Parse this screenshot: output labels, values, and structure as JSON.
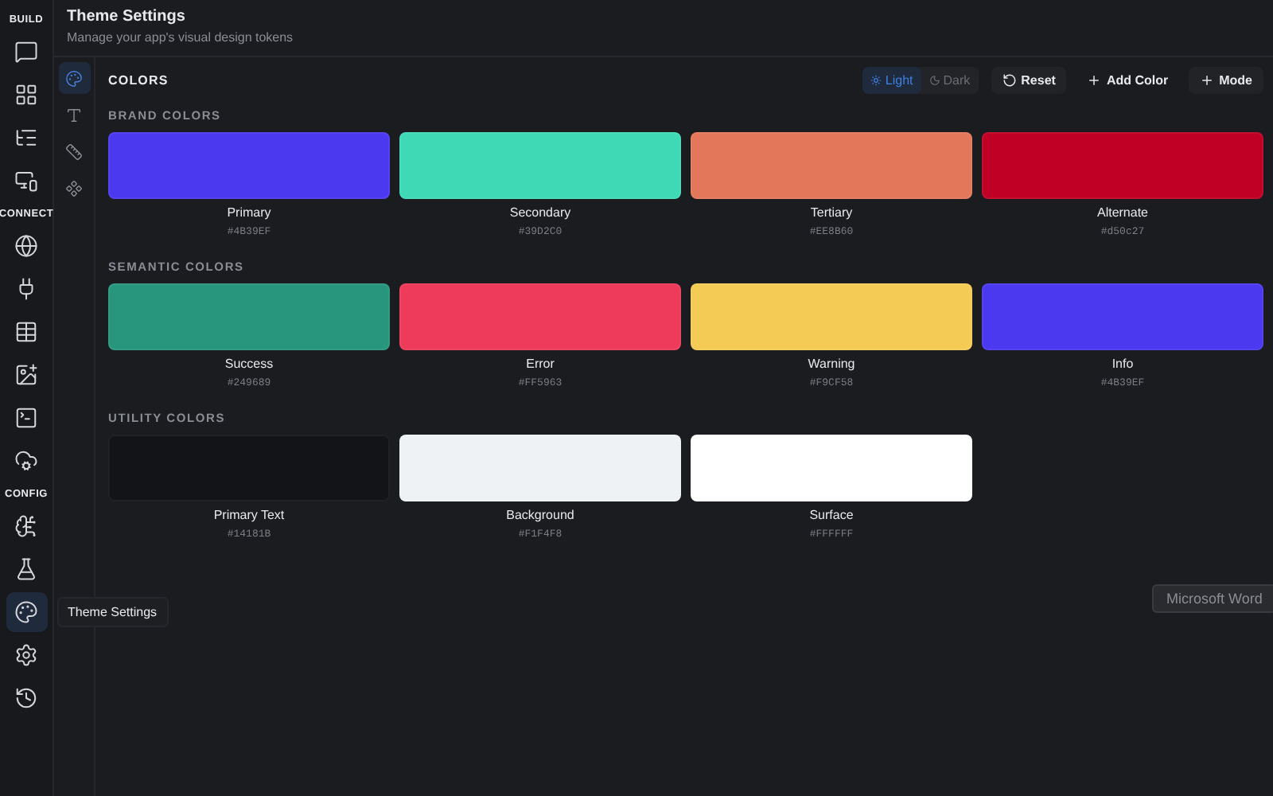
{
  "nav_rail": {
    "sections": [
      {
        "label": "BUILD",
        "items": [
          {
            "selected": false
          },
          {
            "selected": false
          },
          {
            "selected": false
          },
          {
            "selected": false
          }
        ]
      },
      {
        "label": "CONNECT",
        "items": [
          {
            "selected": false
          },
          {
            "selected": false
          },
          {
            "selected": false
          },
          {
            "selected": false
          },
          {
            "selected": false
          },
          {
            "selected": false
          }
        ]
      },
      {
        "label": "CONFIG",
        "items": [
          {
            "selected": false
          },
          {
            "selected": false
          },
          {
            "selected": true,
            "tooltip": "Theme Settings"
          },
          {
            "selected": false
          },
          {
            "selected": false
          }
        ]
      }
    ]
  },
  "header": {
    "title": "Theme Settings",
    "subtitle": "Manage your app's visual design tokens"
  },
  "sub_rail": [
    {
      "selected": true
    },
    {
      "selected": false
    },
    {
      "selected": false
    },
    {
      "selected": false
    }
  ],
  "toolbar": {
    "title": "COLORS",
    "mode_toggle": [
      {
        "label": "Light",
        "selected": true
      },
      {
        "label": "Dark",
        "selected": false
      }
    ],
    "buttons": [
      {
        "label": "Reset",
        "kind": "filled"
      },
      {
        "label": "Add Color",
        "kind": "plain"
      },
      {
        "label": "Mode",
        "kind": "filled"
      }
    ]
  },
  "groups": [
    {
      "title": "BRAND COLORS",
      "swatches": [
        {
          "name": "Primary",
          "hex": "#4B39EF",
          "color": "#4b39ef"
        },
        {
          "name": "Secondary",
          "hex": "#39D2C0",
          "color": "#3fd9b6"
        },
        {
          "name": "Tertiary",
          "hex": "#EE8B60",
          "color": "#e2775a"
        },
        {
          "name": "Alternate",
          "hex": "#d50c27",
          "color": "#c00024"
        }
      ]
    },
    {
      "title": "SEMANTIC COLORS",
      "swatches": [
        {
          "name": "Success",
          "hex": "#249689",
          "color": "#27967c"
        },
        {
          "name": "Error",
          "hex": "#FF5963",
          "color": "#ee3a5b"
        },
        {
          "name": "Warning",
          "hex": "#F9CF58",
          "color": "#f4cb54"
        },
        {
          "name": "Info",
          "hex": "#4B39EF",
          "color": "#4b39ef"
        }
      ]
    },
    {
      "title": "UTILITY COLORS",
      "swatches": [
        {
          "name": "Primary Text",
          "hex": "#14181B",
          "color": "#131418"
        },
        {
          "name": "Background",
          "hex": "#F1F4F8",
          "color": "#eff2f5"
        },
        {
          "name": "Surface",
          "hex": "#FFFFFF",
          "color": "#ffffff"
        }
      ]
    }
  ],
  "os_tooltip": "Microsoft Word"
}
